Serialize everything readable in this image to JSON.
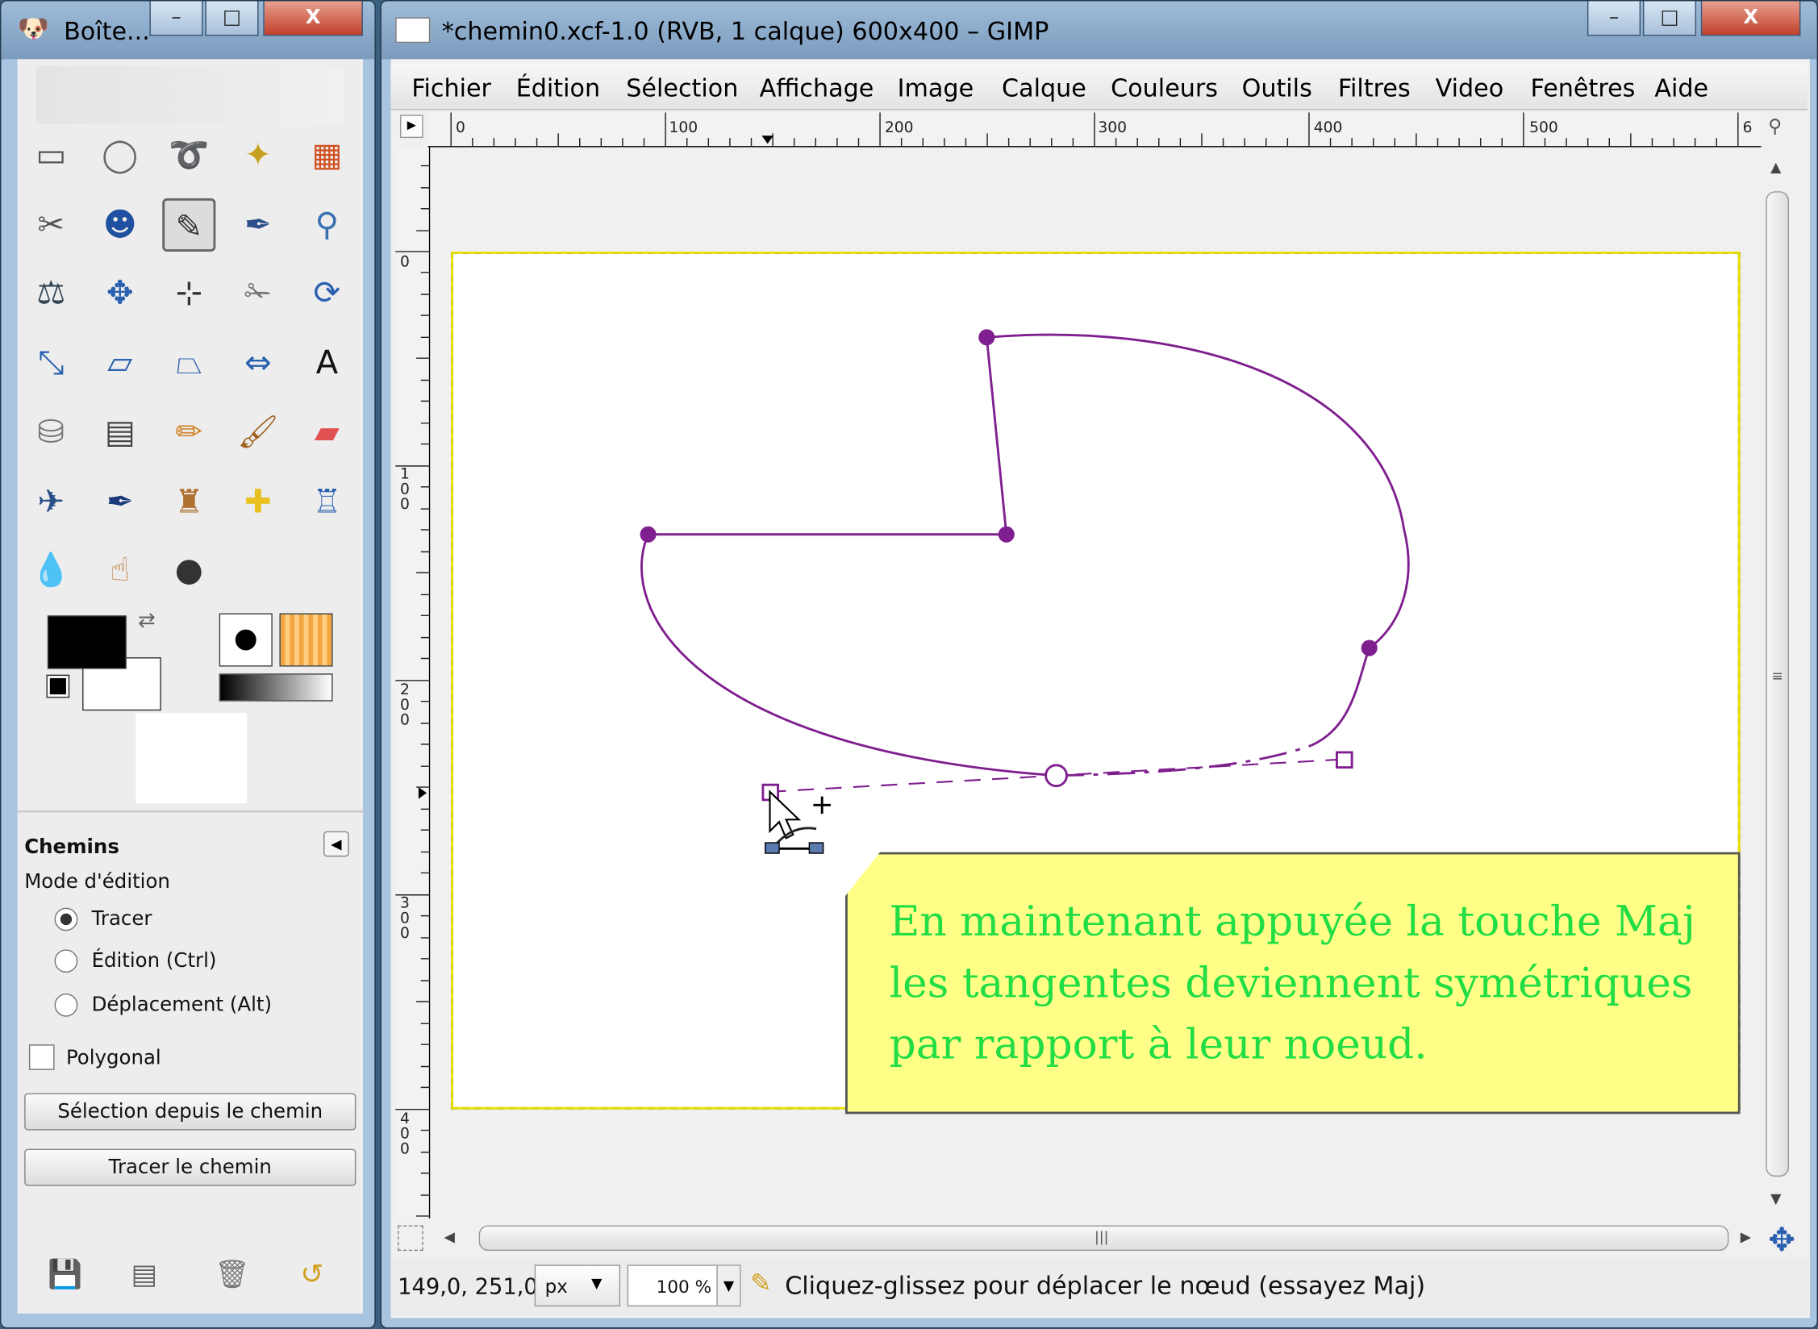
{
  "toolbox": {
    "title": "Boîte...",
    "minimize_icon": "–",
    "maximize_icon": "□",
    "close_icon": "X",
    "tools": [
      {
        "name": "rect-select-icon",
        "glyph": "▭",
        "color": "#555"
      },
      {
        "name": "ellipse-select-icon",
        "glyph": "◯",
        "color": "#666"
      },
      {
        "name": "free-select-icon",
        "glyph": "➰",
        "color": "#777"
      },
      {
        "name": "fuzzy-select-icon",
        "glyph": "✦",
        "color": "#c8a020"
      },
      {
        "name": "color-select-icon",
        "glyph": "▦",
        "color": "#d05020"
      },
      {
        "name": "scissors-icon",
        "glyph": "✂",
        "color": "#555"
      },
      {
        "name": "foreground-select-icon",
        "glyph": "☻",
        "color": "#2050a0"
      },
      {
        "name": "paths-tool-icon",
        "glyph": "✎",
        "color": "#333",
        "selected": true
      },
      {
        "name": "color-picker-icon",
        "glyph": "✒",
        "color": "#2a4f8a"
      },
      {
        "name": "zoom-icon",
        "glyph": "⚲",
        "color": "#3a6fb0"
      },
      {
        "name": "measure-icon",
        "glyph": "⚖",
        "color": "#345"
      },
      {
        "name": "move-icon",
        "glyph": "✥",
        "color": "#2a60b0"
      },
      {
        "name": "align-icon",
        "glyph": "⊹",
        "color": "#333"
      },
      {
        "name": "crop-icon",
        "glyph": "✁",
        "color": "#777"
      },
      {
        "name": "rotate-icon",
        "glyph": "⟳",
        "color": "#2a60b0"
      },
      {
        "name": "scale-icon",
        "glyph": "⤡",
        "color": "#2a60b0"
      },
      {
        "name": "shear-icon",
        "glyph": "▱",
        "color": "#2a60b0"
      },
      {
        "name": "perspective-icon",
        "glyph": "⏢",
        "color": "#2a60b0"
      },
      {
        "name": "flip-icon",
        "glyph": "⇔",
        "color": "#2a60b0"
      },
      {
        "name": "text-icon",
        "glyph": "A",
        "color": "#111"
      },
      {
        "name": "bucket-fill-icon",
        "glyph": "⛁",
        "color": "#777"
      },
      {
        "name": "blend-icon",
        "glyph": "▤",
        "color": "#444"
      },
      {
        "name": "pencil-icon",
        "glyph": "✏",
        "color": "#d08020"
      },
      {
        "name": "paintbrush-icon",
        "glyph": "🖌",
        "color": "#a06020"
      },
      {
        "name": "eraser-icon",
        "glyph": "▰",
        "color": "#e05050"
      },
      {
        "name": "airbrush-icon",
        "glyph": "✈",
        "color": "#2a4f8a"
      },
      {
        "name": "ink-icon",
        "glyph": "✒",
        "color": "#1a3a7a"
      },
      {
        "name": "clone-icon",
        "glyph": "♜",
        "color": "#b07030"
      },
      {
        "name": "heal-icon",
        "glyph": "✚",
        "color": "#e8c020"
      },
      {
        "name": "perspective-clone-icon",
        "glyph": "♖",
        "color": "#2a60b0"
      },
      {
        "name": "blur-icon",
        "glyph": "💧",
        "color": "#3a7fc0"
      },
      {
        "name": "smudge-icon",
        "glyph": "☝",
        "color": "#c08040"
      },
      {
        "name": "dodge-burn-icon",
        "glyph": "●",
        "color": "#333"
      }
    ],
    "colors": {
      "fg": "#000000",
      "bg": "#ffffff"
    },
    "options": {
      "title": "Chemins",
      "mode_label": "Mode d'édition",
      "radio_tracer": "Tracer",
      "radio_edition": "Édition (Ctrl)",
      "radio_deplacement": "Déplacement (Alt)",
      "checkbox_polygonal": "Polygonal",
      "button_selection": "Sélection depuis le chemin",
      "button_tracer": "Tracer le chemin"
    }
  },
  "image_window": {
    "title": "*chemin0.xcf-1.0 (RVB, 1 calque) 600x400 – GIMP",
    "minimize_icon": "–",
    "maximize_icon": "□",
    "close_icon": "X",
    "menu": [
      "Fichier",
      "Édition",
      "Sélection",
      "Affichage",
      "Image",
      "Calque",
      "Couleurs",
      "Outils",
      "Filtres",
      "Video",
      "Fenêtres",
      "Aide"
    ],
    "hruler_labels": [
      "0",
      "100",
      "200",
      "300",
      "400",
      "500",
      "6"
    ],
    "vruler_labels": [
      "0",
      "1\n0\n0",
      "2\n0\n0",
      "3\n0\n0",
      "4\n0\n0"
    ],
    "path_color": "#7f1f8f",
    "callout": {
      "text": "En maintenant appuyée la touche Maj les tangentes deviennent symétriques par rapport à leur noeud.",
      "bg": "#ffff88",
      "fg": "#22dd44"
    },
    "status": {
      "coords": "149,0, 251,0",
      "unit": "px",
      "zoom": "100 %",
      "message": "Cliquez-glissez pour déplacer le nœud (essayez Maj)"
    }
  }
}
